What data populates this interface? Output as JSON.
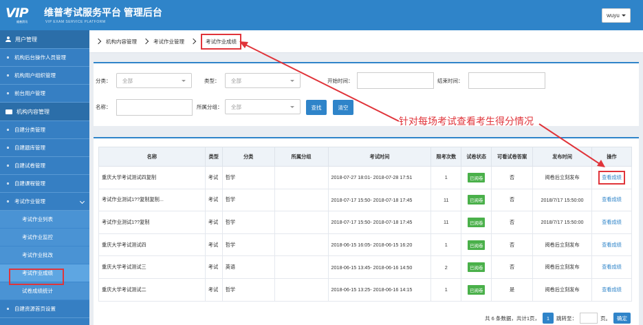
{
  "header": {
    "logo_text": "VIP",
    "logo_sub": "维普资讯",
    "brand_title": "维普考试服务平台 管理后台",
    "brand_sub": "VIP EXAM SERVICE PLATFORM",
    "user": "wuyu"
  },
  "sidebar": {
    "group1": "用户管理",
    "group1_items": [
      "机构后台操作人员管理",
      "机构用户组织管理",
      "前台用户管理"
    ],
    "group2": "机构内容管理",
    "group2_items": [
      "自建分类管理",
      "自建题库管理",
      "自建试卷管理",
      "自建课程管理",
      "考试作业管理"
    ],
    "sub_items": [
      "考试作业列表",
      "考试作业监控",
      "考试作业批改",
      "考试作业成绩",
      "试卷成绩统计"
    ],
    "last_item": "自建资源首页设置"
  },
  "breadcrumb": {
    "item1": "机构内容管理",
    "item2": "考试作业管理",
    "current": "考试作业成绩"
  },
  "filter": {
    "category_label": "分类：",
    "category_value": "全部",
    "type_label": "类型：",
    "type_value": "全部",
    "start_label": "开始时间：",
    "end_label": "结束时间：",
    "name_label": "名称：",
    "group_label": "所属分组：",
    "group_value": "全部",
    "search_button": "查找",
    "clear_button": "清空"
  },
  "annotation": "针对每场考试查看考生得分情况",
  "table": {
    "headers": [
      "名称",
      "类型",
      "分类",
      "所属分组",
      "考试时间",
      "限考次数",
      "试卷状态",
      "可看试卷答案",
      "发布时间",
      "操作"
    ],
    "rows": [
      {
        "name": "重庆大学考试测试四复制",
        "type": "考试",
        "category": "哲学",
        "group": "",
        "time": "2018-07-27 18:01- 2018-07-28 17:51",
        "limit": "1",
        "status": "已阅卷",
        "answer": "否",
        "publish": "阅卷后立刻发布",
        "action": "查看成绩"
      },
      {
        "name": "考试作业测试1??复制复制...",
        "type": "考试",
        "category": "哲学",
        "group": "",
        "time": "2018-07-17 15:50- 2018-07-18 17:45",
        "limit": "11",
        "status": "已阅卷",
        "answer": "否",
        "publish": "2018/7/17 15:50:00",
        "action": "查看成绩"
      },
      {
        "name": "考试作业测试1??复制",
        "type": "考试",
        "category": "哲学",
        "group": "",
        "time": "2018-07-17 15:50- 2018-07-18 17:45",
        "limit": "11",
        "status": "已阅卷",
        "answer": "否",
        "publish": "2018/7/17 15:50:00",
        "action": "查看成绩"
      },
      {
        "name": "重庆大学考试测试四",
        "type": "考试",
        "category": "哲学",
        "group": "",
        "time": "2018-06-15 16:05- 2018-06-15 16:20",
        "limit": "1",
        "status": "已阅卷",
        "answer": "否",
        "publish": "阅卷后立刻发布",
        "action": "查看成绩"
      },
      {
        "name": "重庆大学考试测试三",
        "type": "考试",
        "category": "英语",
        "group": "",
        "time": "2018-06-15 13:45- 2018-06-16 14:50",
        "limit": "2",
        "status": "已阅卷",
        "answer": "否",
        "publish": "阅卷后立刻发布",
        "action": "查看成绩"
      },
      {
        "name": "重庆大学考试测试二",
        "type": "考试",
        "category": "哲学",
        "group": "",
        "time": "2018-06-15 13:25- 2018-06-16 14:15",
        "limit": "1",
        "status": "已阅卷",
        "answer": "是",
        "publish": "阅卷后立刻发布",
        "action": "查看成绩"
      }
    ]
  },
  "pager": {
    "summary": "共 6 条数据，共计1页，",
    "page": "1",
    "jump_label": "跳转至：",
    "page_suffix": "页。",
    "confirm": "确定"
  },
  "colors": {
    "primary": "#2f84c9",
    "highlight": "#e0343a",
    "success": "#4ab04a"
  }
}
